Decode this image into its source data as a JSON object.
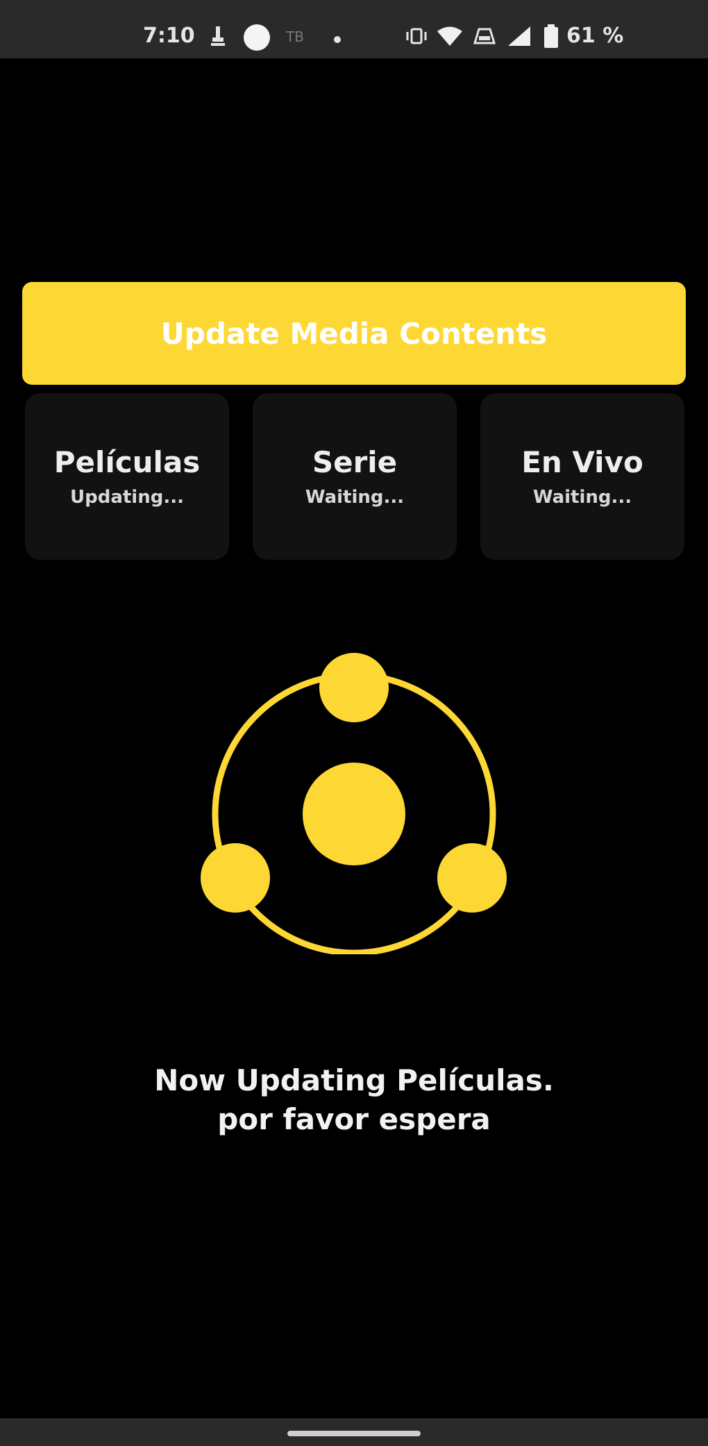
{
  "status_bar": {
    "time": "7:10",
    "battery": "61 %",
    "icons": [
      "usb-icon",
      "circle-notification-icon",
      "app-notification-icon",
      "dot-icon",
      "vibrate-icon",
      "wifi-icon",
      "data-icon",
      "signal-icon",
      "battery-icon"
    ]
  },
  "update_button": {
    "label": "Update Media Contents"
  },
  "categories": [
    {
      "name": "Películas",
      "status": "Updating..."
    },
    {
      "name": "Serie",
      "status": "Waiting..."
    },
    {
      "name": "En Vivo",
      "status": "Waiting..."
    }
  ],
  "message": {
    "line1": "Now Updating Películas.",
    "line2": "por favor espera"
  },
  "colors": {
    "accent": "#fdd835",
    "background": "#000000",
    "card": "#121212"
  }
}
